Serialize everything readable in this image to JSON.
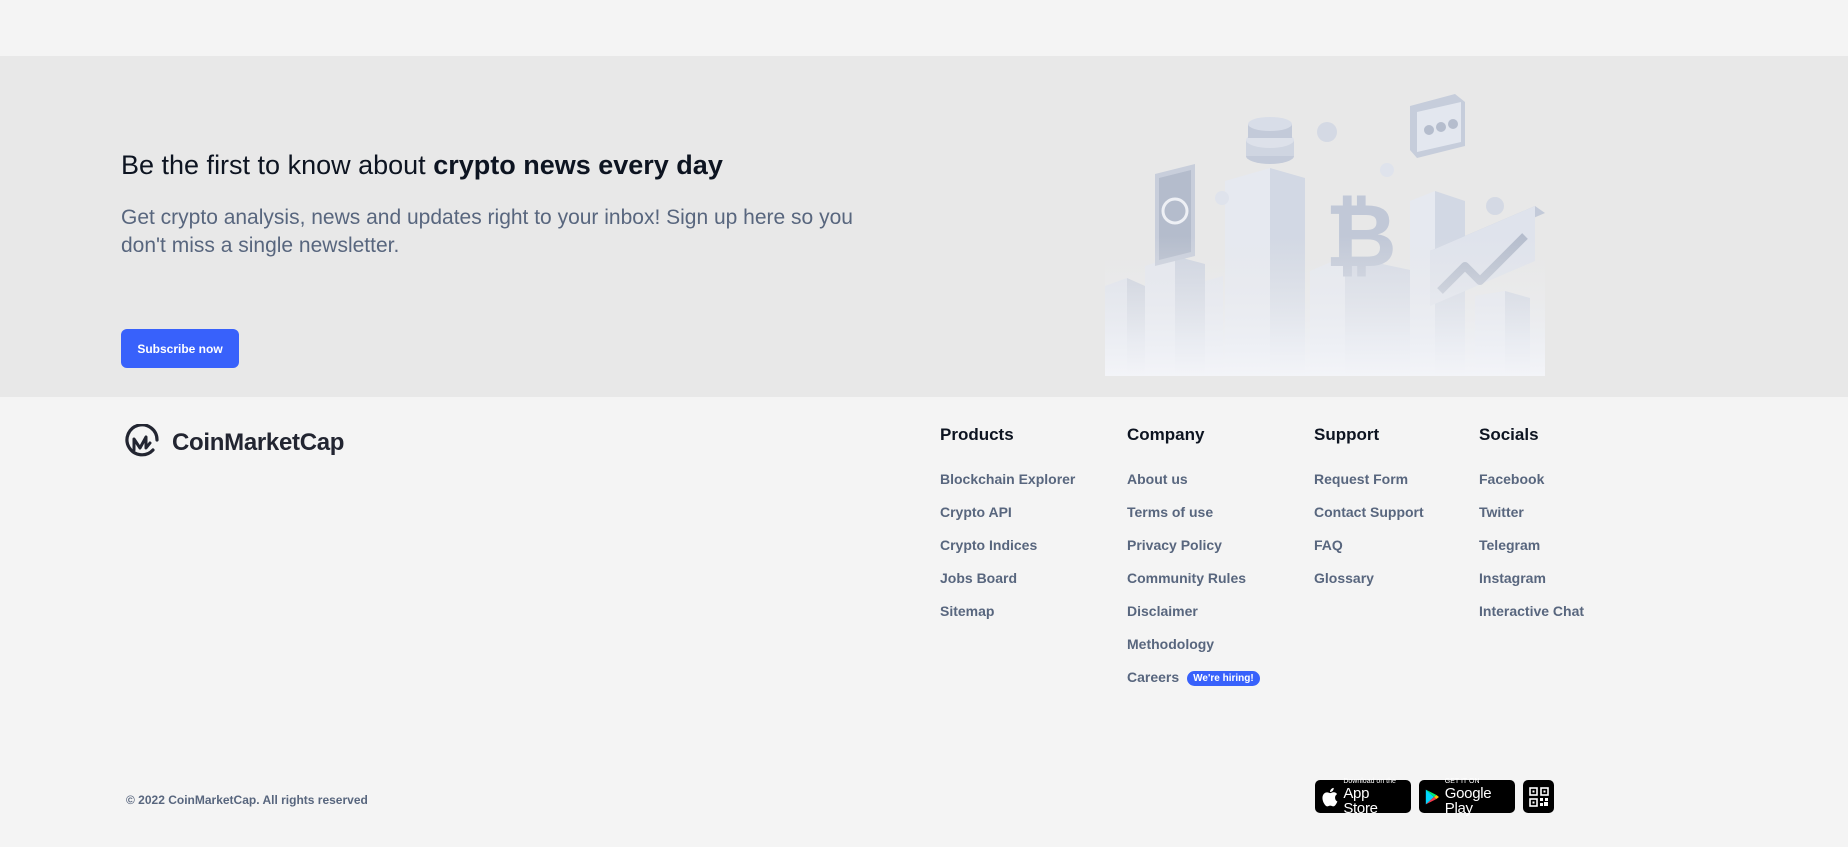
{
  "banner": {
    "title_prefix": "Be the first to know about ",
    "title_bold": "crypto news every day",
    "description": "Get crypto analysis, news and updates right to your inbox! Sign up here so you don't miss a single newsletter.",
    "subscribe_label": "Subscribe now"
  },
  "footer": {
    "logo_text": "CoinMarketCap",
    "columns": [
      {
        "heading": "Products",
        "links": [
          "Blockchain Explorer",
          "Crypto API",
          "Crypto Indices",
          "Jobs Board",
          "Sitemap"
        ]
      },
      {
        "heading": "Company",
        "links": [
          "About us",
          "Terms of use",
          "Privacy Policy",
          "Community Rules",
          "Disclaimer",
          "Methodology",
          "Careers"
        ],
        "badge": "We're hiring!"
      },
      {
        "heading": "Support",
        "links": [
          "Request Form",
          "Contact Support",
          "FAQ",
          "Glossary"
        ]
      },
      {
        "heading": "Socials",
        "links": [
          "Facebook",
          "Twitter",
          "Telegram",
          "Instagram",
          "Interactive Chat"
        ]
      }
    ],
    "copyright": "© 2022 CoinMarketCap. All rights reserved",
    "app_store": {
      "small": "Download on the",
      "big": "App Store"
    },
    "google_play": {
      "small": "GET IT ON",
      "big": "Google Play"
    }
  },
  "colors": {
    "accent": "#3861fb",
    "text_primary": "#0d1421",
    "text_secondary": "#58667e",
    "banner_bg": "#e8e8e8",
    "page_bg": "#f4f4f4"
  },
  "icons": [
    "coinmarketcap-logo-icon",
    "crypto-city-illustration",
    "apple-icon",
    "google-play-icon",
    "qr-code-icon"
  ]
}
